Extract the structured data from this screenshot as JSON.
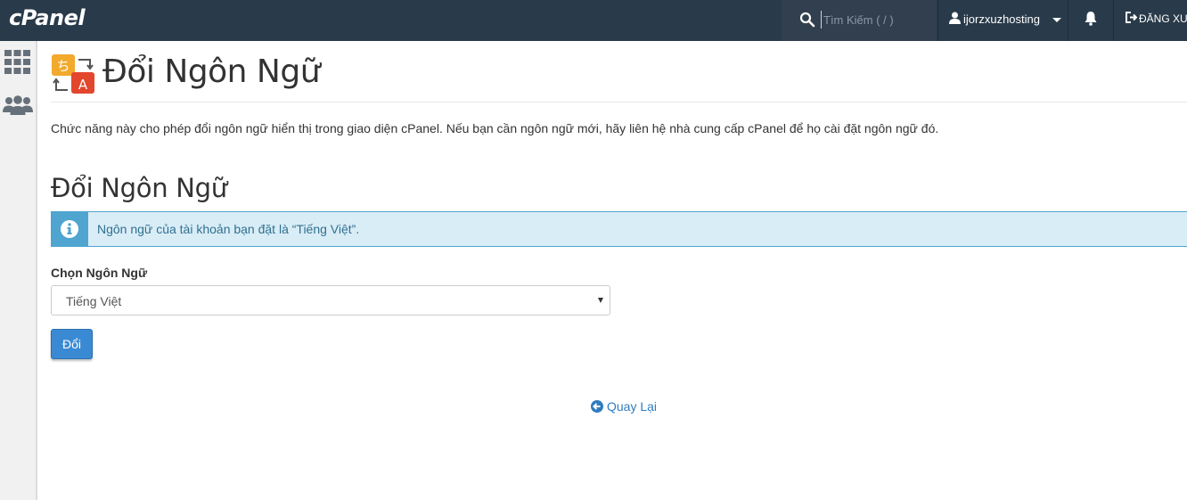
{
  "topbar": {
    "logo": "cPanel",
    "search_placeholder": "Tìm Kiếm ( / )",
    "username": "ijorzxuzhosting",
    "logout_label": "ĐĂNG XUẤT"
  },
  "sidebar": {
    "items": [
      {
        "icon": "grid-icon"
      },
      {
        "icon": "users-icon"
      }
    ]
  },
  "page": {
    "title": "Đổi Ngôn Ngữ",
    "description": "Chức năng này cho phép đổi ngôn ngữ hiển thị trong giao diện cPanel. Nếu bạn cần ngôn ngữ mới, hãy liên hệ nhà cung cấp cPanel để họ cài đặt ngôn ngữ đó.",
    "section_title": "Đổi Ngôn Ngữ",
    "alert_text": "Ngôn ngữ của tài khoản bạn đặt là “Tiếng Việt”.",
    "select_label": "Chọn Ngôn Ngữ",
    "select_value": "Tiếng Việt",
    "button_label": "Đổi",
    "back_label": "Quay Lại"
  },
  "colors": {
    "topbar": "#293a4a",
    "accent": "#3a8ad3",
    "alert_bg": "#d9edf7",
    "alert_border": "#4fa5d0"
  }
}
